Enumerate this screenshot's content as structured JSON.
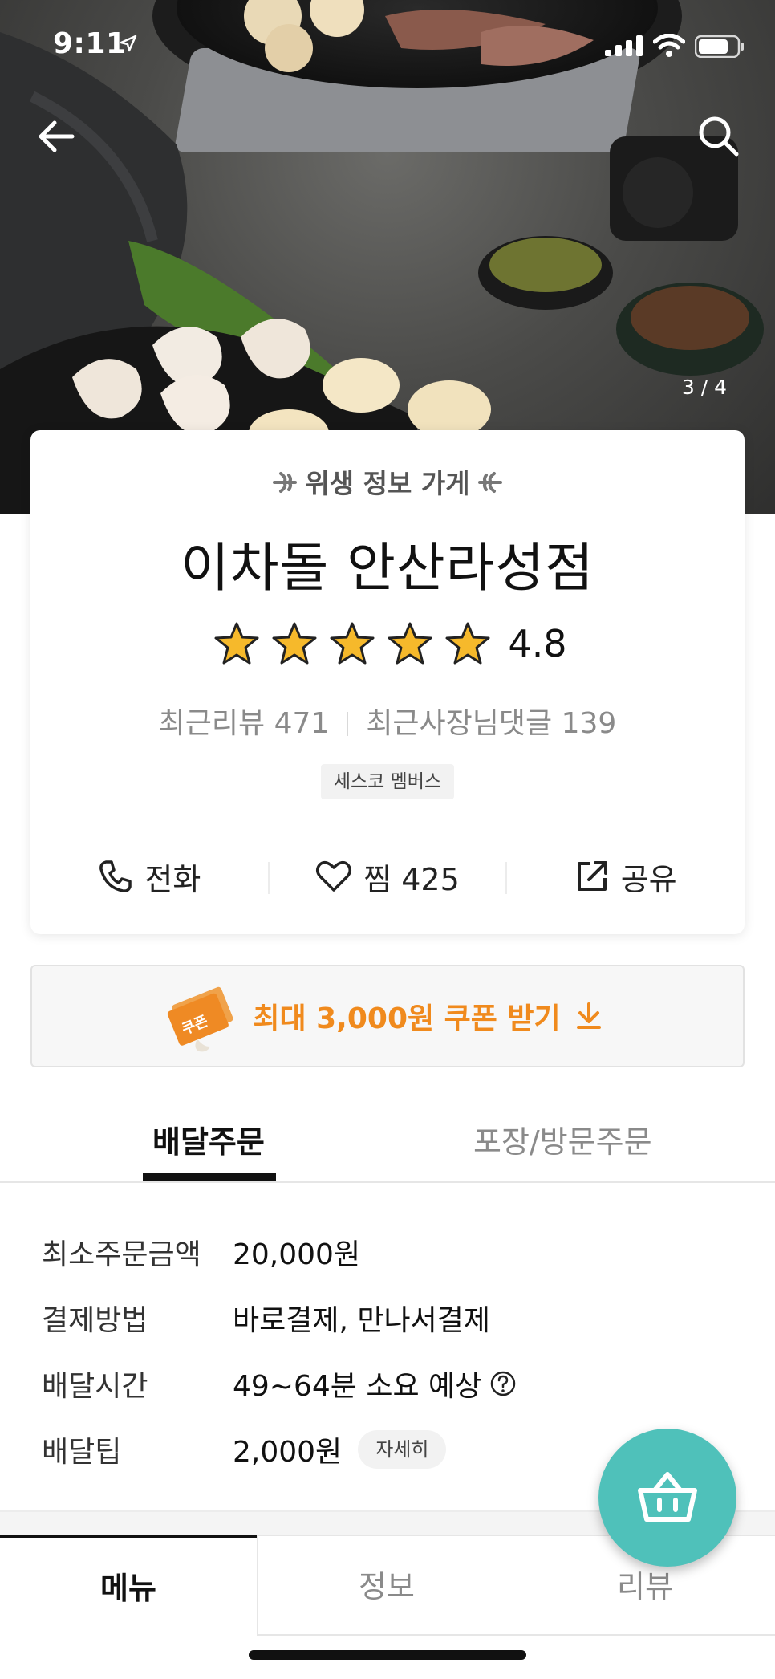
{
  "status_bar": {
    "time": "9:11"
  },
  "hero": {
    "pager": "3 / 4"
  },
  "store": {
    "badge": "위생 정보 가게",
    "name": "이차돌 안산라성점",
    "rating": "4.8",
    "star_count": 5,
    "recent_reviews": "최근리뷰 471",
    "recent_replies": "최근사장님댓글 139",
    "membership": "세스코 멤버스",
    "actions": {
      "call": "전화",
      "like": "찜 425",
      "share": "공유"
    }
  },
  "coupon": {
    "icon_label": "쿠폰",
    "text": "최대 3,000원 쿠폰 받기"
  },
  "order_tabs": {
    "delivery": "배달주문",
    "pickup": "포장/방문주문"
  },
  "info": {
    "rows": [
      {
        "label": "최소주문금액",
        "value": "20,000원"
      },
      {
        "label": "결제방법",
        "value": "바로결제, 만나서결제"
      },
      {
        "label": "배달시간",
        "value": "49~64분 소요 예상"
      },
      {
        "label": "배달팁",
        "value": "2,000원"
      }
    ],
    "detail_button": "자세히"
  },
  "bottom_tabs": {
    "menu": "메뉴",
    "info": "정보",
    "review": "리뷰"
  },
  "colors": {
    "accent_orange": "#f08a1d",
    "cart_teal": "#4fc1ba",
    "star_gold": "#f6b92b"
  },
  "icons": [
    "location-arrow-icon",
    "signal-icon",
    "wifi-icon",
    "battery-icon",
    "back-arrow-icon",
    "search-icon",
    "leaf-icon",
    "star-icon",
    "phone-icon",
    "heart-icon",
    "share-icon",
    "coupon-icon",
    "download-arrow-icon",
    "help-icon",
    "cart-icon"
  ]
}
